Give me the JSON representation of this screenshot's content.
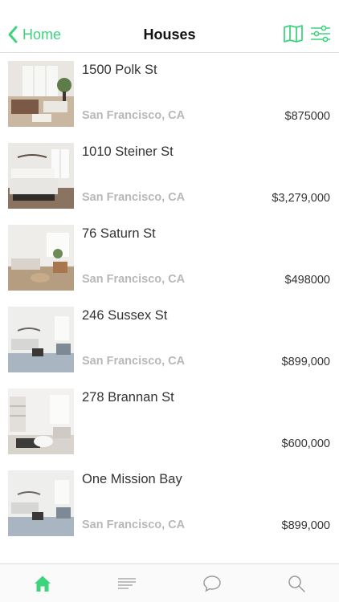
{
  "nav": {
    "back_label": "Home",
    "title": "Houses",
    "icons": [
      "map-icon",
      "filter-sliders-icon"
    ]
  },
  "accent_color": "#3ed47e",
  "listings": [
    {
      "street": "1500 Polk St",
      "city": "San Francisco, CA",
      "price": "$875000"
    },
    {
      "street": "1010 Steiner St",
      "city": "San Francisco, CA",
      "price": "$3,279,000"
    },
    {
      "street": "76 Saturn St",
      "city": "San Francisco, CA",
      "price": "$498000"
    },
    {
      "street": "246 Sussex St",
      "city": "San Francisco, CA",
      "price": "$899,000"
    },
    {
      "street": "278 Brannan St",
      "city": "",
      "price": "$600,000"
    },
    {
      "street": "One Mission Bay",
      "city": "San Francisco, CA",
      "price": "$899,000"
    }
  ],
  "tabbar": {
    "items": [
      "home-icon",
      "list-icon",
      "chat-icon",
      "search-icon"
    ],
    "active": "home-icon"
  }
}
